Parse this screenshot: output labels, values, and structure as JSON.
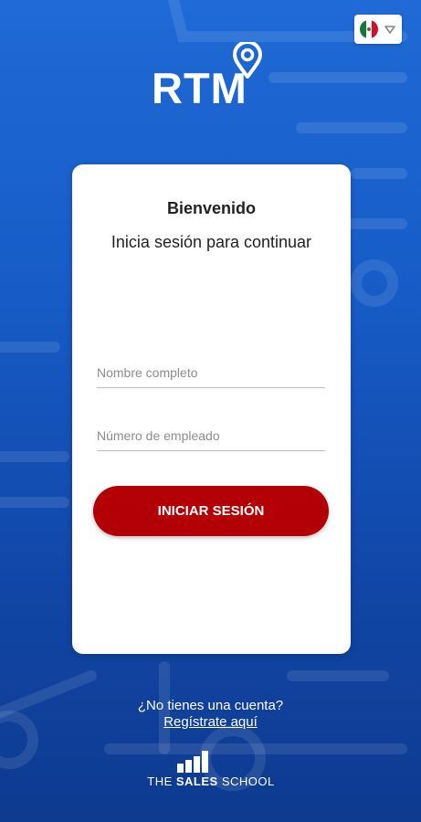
{
  "app": {
    "brand": "RTM",
    "language": {
      "flag": "mexico-flag",
      "selected": "es-MX"
    }
  },
  "card": {
    "title": "Bienvenido",
    "subtitle": "Inicia sesión para continuar"
  },
  "form": {
    "name_placeholder": "Nombre completo",
    "name_value": "",
    "employee_placeholder": "Número de empleado",
    "employee_value": "",
    "login_label": "INICIAR SESIÓN"
  },
  "signup": {
    "prompt": "¿No tienes una cuenta?",
    "link": "Regístrate aquí"
  },
  "footer": {
    "brand_left": "THE",
    "brand_mid": "SALES",
    "brand_right": "SCHOOL"
  },
  "colors": {
    "background_top": "#1f6ad6",
    "background_bottom": "#0e3a8f",
    "button": "#b20006",
    "card": "#ffffff"
  }
}
